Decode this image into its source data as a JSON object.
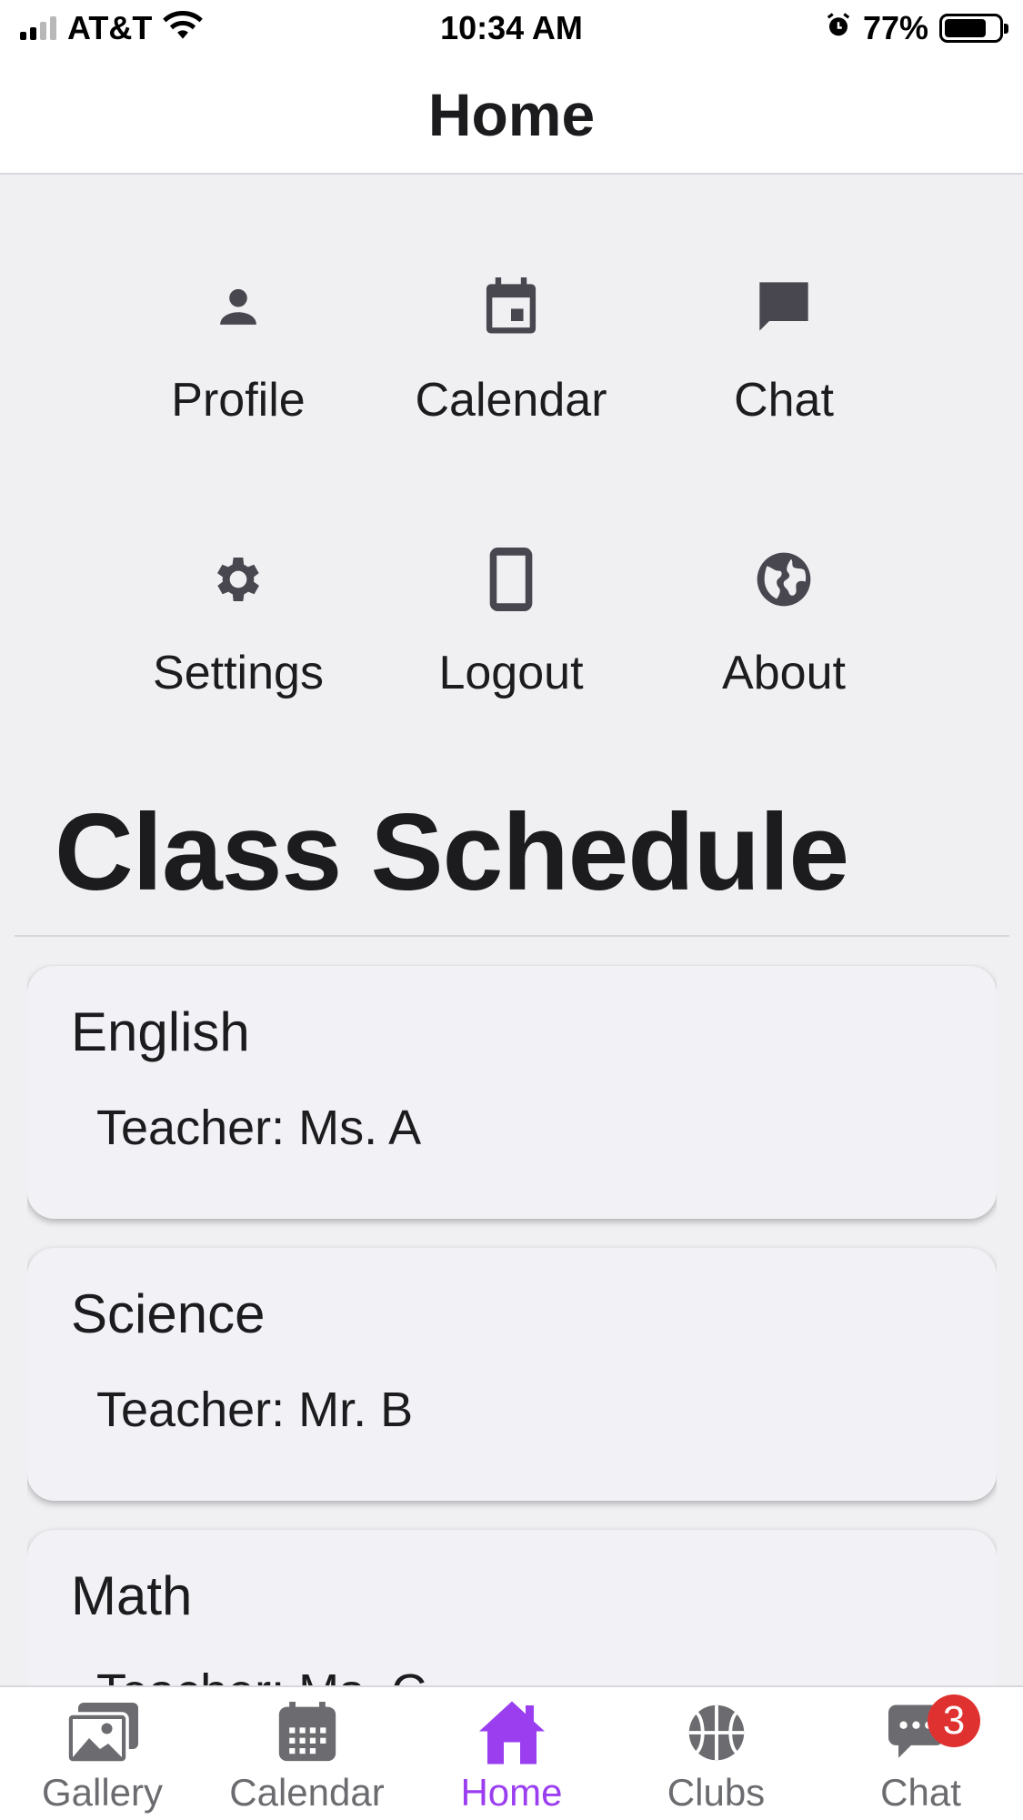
{
  "status_bar": {
    "carrier": "AT&T",
    "time": "10:34 AM",
    "battery_percent": "77%",
    "battery_level": 0.77,
    "icons": [
      "signal-icon",
      "wifi-icon",
      "alarm-icon",
      "battery-icon"
    ]
  },
  "header": {
    "title": "Home"
  },
  "menu": {
    "items": [
      {
        "label": "Profile",
        "icon": "person-icon"
      },
      {
        "label": "Calendar",
        "icon": "calendar-icon"
      },
      {
        "label": "Chat",
        "icon": "chat-bubble-icon"
      },
      {
        "label": "Settings",
        "icon": "gear-icon"
      },
      {
        "label": "Logout",
        "icon": "phone-icon"
      },
      {
        "label": "About",
        "icon": "globe-icon"
      }
    ],
    "icon_color": "#48464f"
  },
  "schedule": {
    "title": "Class Schedule",
    "classes": [
      {
        "name": "English",
        "teacher": "Teacher: Ms. A"
      },
      {
        "name": "Science",
        "teacher": "Teacher: Mr. B"
      },
      {
        "name": "Math",
        "teacher": "Teacher: Ms. C"
      }
    ]
  },
  "tab_bar": {
    "tabs": [
      {
        "label": "Gallery",
        "icon": "gallery-icon",
        "active": false
      },
      {
        "label": "Calendar",
        "icon": "calendar-icon",
        "active": false
      },
      {
        "label": "Home",
        "icon": "home-icon",
        "active": true
      },
      {
        "label": "Clubs",
        "icon": "basketball-icon",
        "active": false
      },
      {
        "label": "Chat",
        "icon": "chat-icon",
        "active": false,
        "badge": "3"
      }
    ],
    "active_color": "#9b3ef0",
    "inactive_color": "#6c6c70",
    "badge_color": "#e03131"
  }
}
